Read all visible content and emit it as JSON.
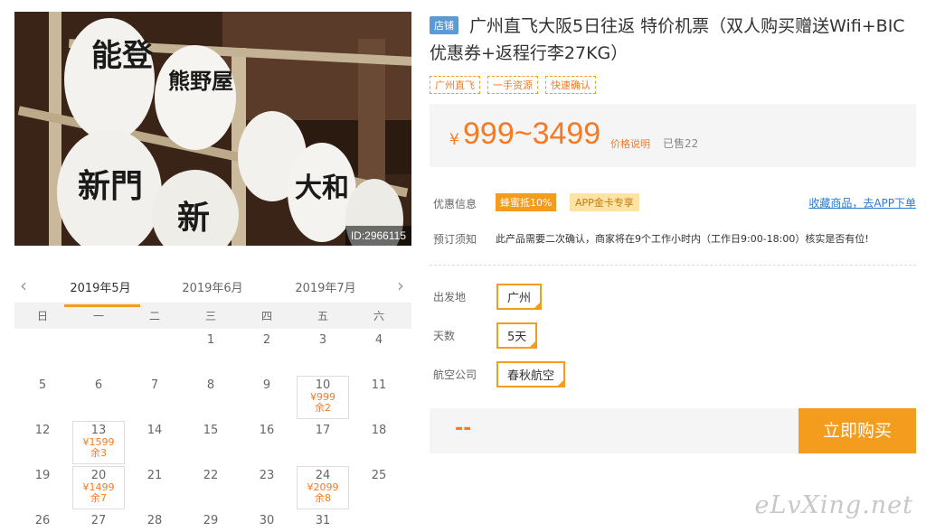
{
  "photo": {
    "id_label": "ID:2966115",
    "lantern_chars": [
      "能登",
      "熊野屋",
      "新門",
      "大和",
      "新"
    ]
  },
  "calendar": {
    "prev_arrow": "‹",
    "next_arrow": "›",
    "months": [
      "2019年5月",
      "2019年6月",
      "2019年7月"
    ],
    "weekdays": [
      "日",
      "一",
      "二",
      "三",
      "四",
      "五",
      "六"
    ],
    "days": [
      {
        "d": ""
      },
      {
        "d": ""
      },
      {
        "d": ""
      },
      {
        "d": "1"
      },
      {
        "d": "2"
      },
      {
        "d": "3"
      },
      {
        "d": "4"
      },
      {
        "d": "5"
      },
      {
        "d": "6"
      },
      {
        "d": "7"
      },
      {
        "d": "8"
      },
      {
        "d": "9"
      },
      {
        "d": "10",
        "price": "¥999",
        "left": "余2"
      },
      {
        "d": "11"
      },
      {
        "d": "12"
      },
      {
        "d": "13",
        "price": "¥1599",
        "left": "余3"
      },
      {
        "d": "14"
      },
      {
        "d": "15"
      },
      {
        "d": "16"
      },
      {
        "d": "17"
      },
      {
        "d": "18"
      },
      {
        "d": "19"
      },
      {
        "d": "20",
        "price": "¥1499",
        "left": "余7"
      },
      {
        "d": "21"
      },
      {
        "d": "22"
      },
      {
        "d": "23"
      },
      {
        "d": "24",
        "price": "¥2099",
        "left": "余8"
      },
      {
        "d": "25"
      },
      {
        "d": "26"
      },
      {
        "d": "27"
      },
      {
        "d": "28"
      },
      {
        "d": "29"
      },
      {
        "d": "30"
      },
      {
        "d": "31"
      },
      {
        "d": ""
      }
    ]
  },
  "product": {
    "shop_badge": "店铺",
    "title": "广州直飞大阪5日往返 特价机票（双人购买赠送Wifi+BIC优惠券+返程行李27KG）",
    "tags": [
      "广州直飞",
      "一手资源",
      "快速确认"
    ],
    "price_symbol": "¥",
    "price_range": "999~3499",
    "price_explain": "价格说明",
    "sold": "已售22",
    "promo_label": "优惠信息",
    "promo_tag1": "蜂蜜抵10%",
    "promo_tag2": "APP金卡专享",
    "collect_link": "收藏商品，去APP下单",
    "notice_label": "预订须知",
    "notice_text": "此产品需要二次确认，商家将在9个工作小时内（工作日9:00-18:00）核实是否有位!"
  },
  "options": {
    "departure_label": "出发地",
    "departure_value": "广州",
    "days_label": "天数",
    "days_value": "5天",
    "airline_label": "航空公司",
    "airline_value": "春秋航空"
  },
  "buy": {
    "total": "--",
    "button_label": "立即购买"
  },
  "colors": {
    "accent": "#f39c1e",
    "price": "#f57a22",
    "link": "#2a7bd3"
  },
  "watermark": "eLvXing.net"
}
